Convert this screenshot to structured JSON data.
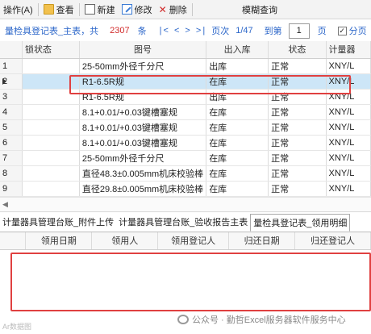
{
  "toolbar": {
    "operate": "操作(A)",
    "view": "查看",
    "new": "新建",
    "edit": "修改",
    "delete": "删除",
    "fuzzy_search": "模糊查询"
  },
  "nav": {
    "title": "量检具登记表_主表，共",
    "total": "2307",
    "unit": "条",
    "arrows": "|< < > >|",
    "page_label": "页次",
    "page": "1/47",
    "goto_label": "到第",
    "goto_value": "1",
    "page_unit": "页",
    "paging_checked": true,
    "paging_label": "分页"
  },
  "grid": {
    "columns": [
      "",
      "锁状态",
      "图号",
      "出入库",
      "状态",
      "计量器"
    ],
    "selected_row": 1,
    "rows": [
      {
        "num": "1",
        "lock": "",
        "drawing": "25-50mm外径千分尺",
        "inout": "出库",
        "status": "正常",
        "meter": "XNY/L"
      },
      {
        "num": "2",
        "lock": "",
        "drawing": "R1-6.5R规",
        "inout": "在库",
        "status": "正常",
        "meter": "XNY/L"
      },
      {
        "num": "3",
        "lock": "",
        "drawing": "R1-6.5R规",
        "inout": "出库",
        "status": "正常",
        "meter": "XNY/L"
      },
      {
        "num": "4",
        "lock": "",
        "drawing": "8.1+0.01/+0.03键槽塞规",
        "inout": "在库",
        "status": "正常",
        "meter": "XNY/L"
      },
      {
        "num": "5",
        "lock": "",
        "drawing": "8.1+0.01/+0.03键槽塞规",
        "inout": "在库",
        "status": "正常",
        "meter": "XNY/L"
      },
      {
        "num": "6",
        "lock": "",
        "drawing": "8.1+0.01/+0.03键槽塞规",
        "inout": "在库",
        "status": "正常",
        "meter": "XNY/L"
      },
      {
        "num": "7",
        "lock": "",
        "drawing": "25-50mm外径千分尺",
        "inout": "在库",
        "status": "正常",
        "meter": "XNY/L"
      },
      {
        "num": "8",
        "lock": "",
        "drawing": "直径48.3±0.005mm机床校验棒",
        "inout": "在库",
        "status": "正常",
        "meter": "XNY/L"
      },
      {
        "num": "9",
        "lock": "",
        "drawing": "直径29.8±0.005mm机床校验棒",
        "inout": "在库",
        "status": "正常",
        "meter": "XNY/L"
      }
    ]
  },
  "tabs": [
    {
      "label": "计量器具管理台账_附件上传",
      "active": false
    },
    {
      "label": "计量器具管理台账_验收报告主表",
      "active": false
    },
    {
      "label": "量检具登记表_领用明细",
      "active": true
    }
  ],
  "detail_grid": {
    "columns": [
      "",
      "领用日期",
      "领用人",
      "领用登记人",
      "归还日期",
      "归还登记人"
    ]
  },
  "watermark": {
    "text": "公众号 · 勤哲Excel服务器软件服务中心",
    "corner": "Ar数据图"
  },
  "colors": {
    "link_blue": "#2b66c9",
    "count_red": "#d12b2b",
    "selection": "#cde6f7",
    "highlight_box": "#e04040"
  }
}
